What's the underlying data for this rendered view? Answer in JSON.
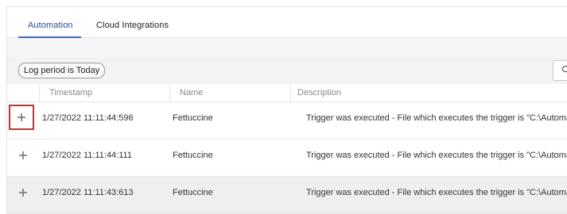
{
  "tabs": [
    {
      "label": "Automation",
      "active": true
    },
    {
      "label": "Cloud Integrations",
      "active": false
    }
  ],
  "filter": {
    "label": "Log period is Today"
  },
  "search": {
    "icon": "search-icon"
  },
  "table": {
    "headers": [
      "Timestamp",
      "Name",
      "Description"
    ],
    "rows": [
      {
        "timestamp": "1/27/2022 11:11:44:596",
        "name": "Fettuccine",
        "description": "Trigger was executed - File which executes the trigger is \"C:\\Automat"
      },
      {
        "timestamp": "1/27/2022 11:11:44:111",
        "name": "Fettuccine",
        "description": "Trigger was executed - File which executes the trigger is \"C:\\Automat"
      },
      {
        "timestamp": "1/27/2022 11:11:43:613",
        "name": "Fettuccine",
        "description": "Trigger was executed - File which executes the trigger is \"C:\\Automat"
      }
    ]
  },
  "colors": {
    "accent": "#2d6fd3",
    "highlight": "#cf2d2d"
  }
}
